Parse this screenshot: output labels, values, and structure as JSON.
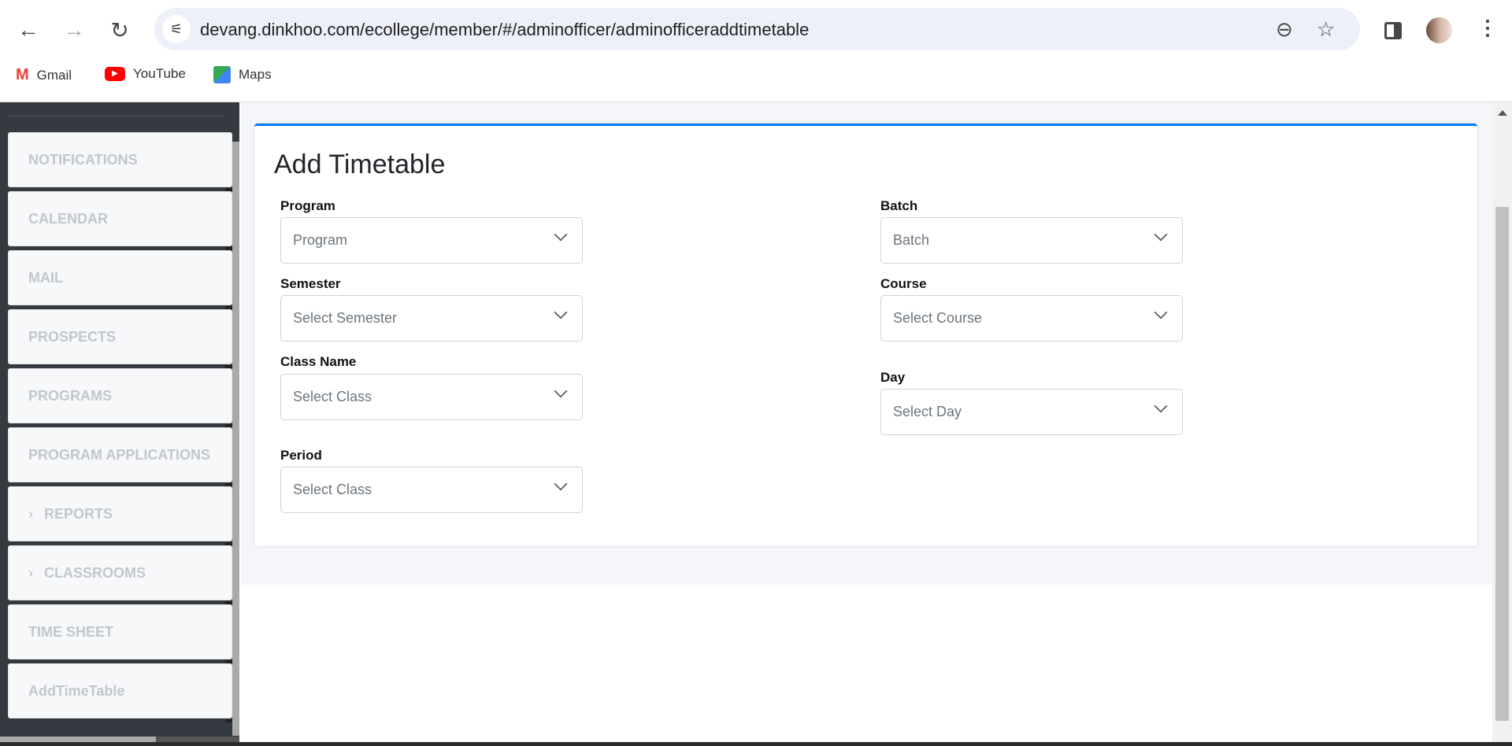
{
  "browser": {
    "url": "devang.dinkhoo.com/ecollege/member/#/adminofficer/adminofficeraddtimetable",
    "bookmarks": [
      {
        "label": "Gmail",
        "icon": "gmail-icon"
      },
      {
        "label": "YouTube",
        "icon": "youtube-icon"
      },
      {
        "label": "Maps",
        "icon": "maps-icon"
      }
    ]
  },
  "sidebar": {
    "items": [
      {
        "label": "NOTIFICATIONS"
      },
      {
        "label": "CALENDAR"
      },
      {
        "label": "MAIL"
      },
      {
        "label": "PROSPECTS"
      },
      {
        "label": "PROGRAMS"
      },
      {
        "label": "PROGRAM APPLICATIONS"
      },
      {
        "label": "REPORTS",
        "chevron": true
      },
      {
        "label": "CLASSROOMS",
        "chevron": true
      },
      {
        "label": "TIME SHEET"
      },
      {
        "label": "AddTimeTable"
      }
    ]
  },
  "form": {
    "title": "Add Timetable",
    "program": {
      "label": "Program",
      "value": "Program"
    },
    "batch": {
      "label": "Batch",
      "value": "Batch"
    },
    "semester": {
      "label": "Semester",
      "value": "Select Semester"
    },
    "course": {
      "label": "Course",
      "value": "Select Course"
    },
    "class_name": {
      "label": "Class Name",
      "value": "Select Class"
    },
    "day": {
      "label": "Day",
      "value": "Select Day"
    },
    "period": {
      "label": "Period",
      "value": "Select Class"
    }
  },
  "colors": {
    "accent": "#007bff",
    "sidebar_bg": "#343a40"
  }
}
